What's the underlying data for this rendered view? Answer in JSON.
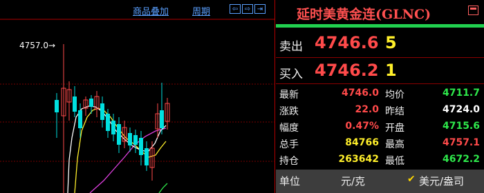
{
  "toolbar": {
    "overlay_label": "商品叠加",
    "period_label": "周期",
    "nav_buttons": [
      "⇦",
      "⇨",
      "⇥"
    ]
  },
  "chart": {
    "high_marker": "4757.0→"
  },
  "chart_data": {
    "type": "candlestick",
    "marked_high": 4757.0
  },
  "panel": {
    "title": "延时美黄金连(GLNC)",
    "sell_label": "卖出",
    "sell_price": "4746.6",
    "sell_volume": "5",
    "buy_label": "买入",
    "buy_price": "4746.2",
    "buy_volume": "1",
    "quotes": [
      {
        "label": "最新",
        "value": "4746.0",
        "color": "#ff4a4a",
        "label2": "均价",
        "value2": "4711.7",
        "color2": "#2ee84b"
      },
      {
        "label": "涨跌",
        "value": "22.0",
        "color": "#ff4a4a",
        "label2": "昨结",
        "value2": "4724.0",
        "color2": "#ffffff"
      },
      {
        "label": "幅度",
        "value": "0.47%",
        "color": "#ff4a4a",
        "label2": "开盘",
        "value2": "4715.6",
        "color2": "#2ee84b"
      },
      {
        "label": "总手",
        "value": "84766",
        "color": "#ffef2a",
        "label2": "最高",
        "value2": "4757.1",
        "color2": "#ff4a4a"
      },
      {
        "label": "持仓",
        "value": "263642",
        "color": "#ffef2a",
        "label2": "最低",
        "value2": "4672.2",
        "color2": "#2ee84b"
      }
    ],
    "unit_label": "单位",
    "unit_value": "元/克",
    "unit_alt": "美元/盎司"
  },
  "colors": {
    "up": "#ff4a4a",
    "down": "#00e0e0",
    "accent": "#21d14f",
    "ma_white": "#ffffff",
    "ma_yellow": "#ffef2a",
    "ma_magenta": "#e040e0",
    "ma_green": "#2ee84b"
  }
}
